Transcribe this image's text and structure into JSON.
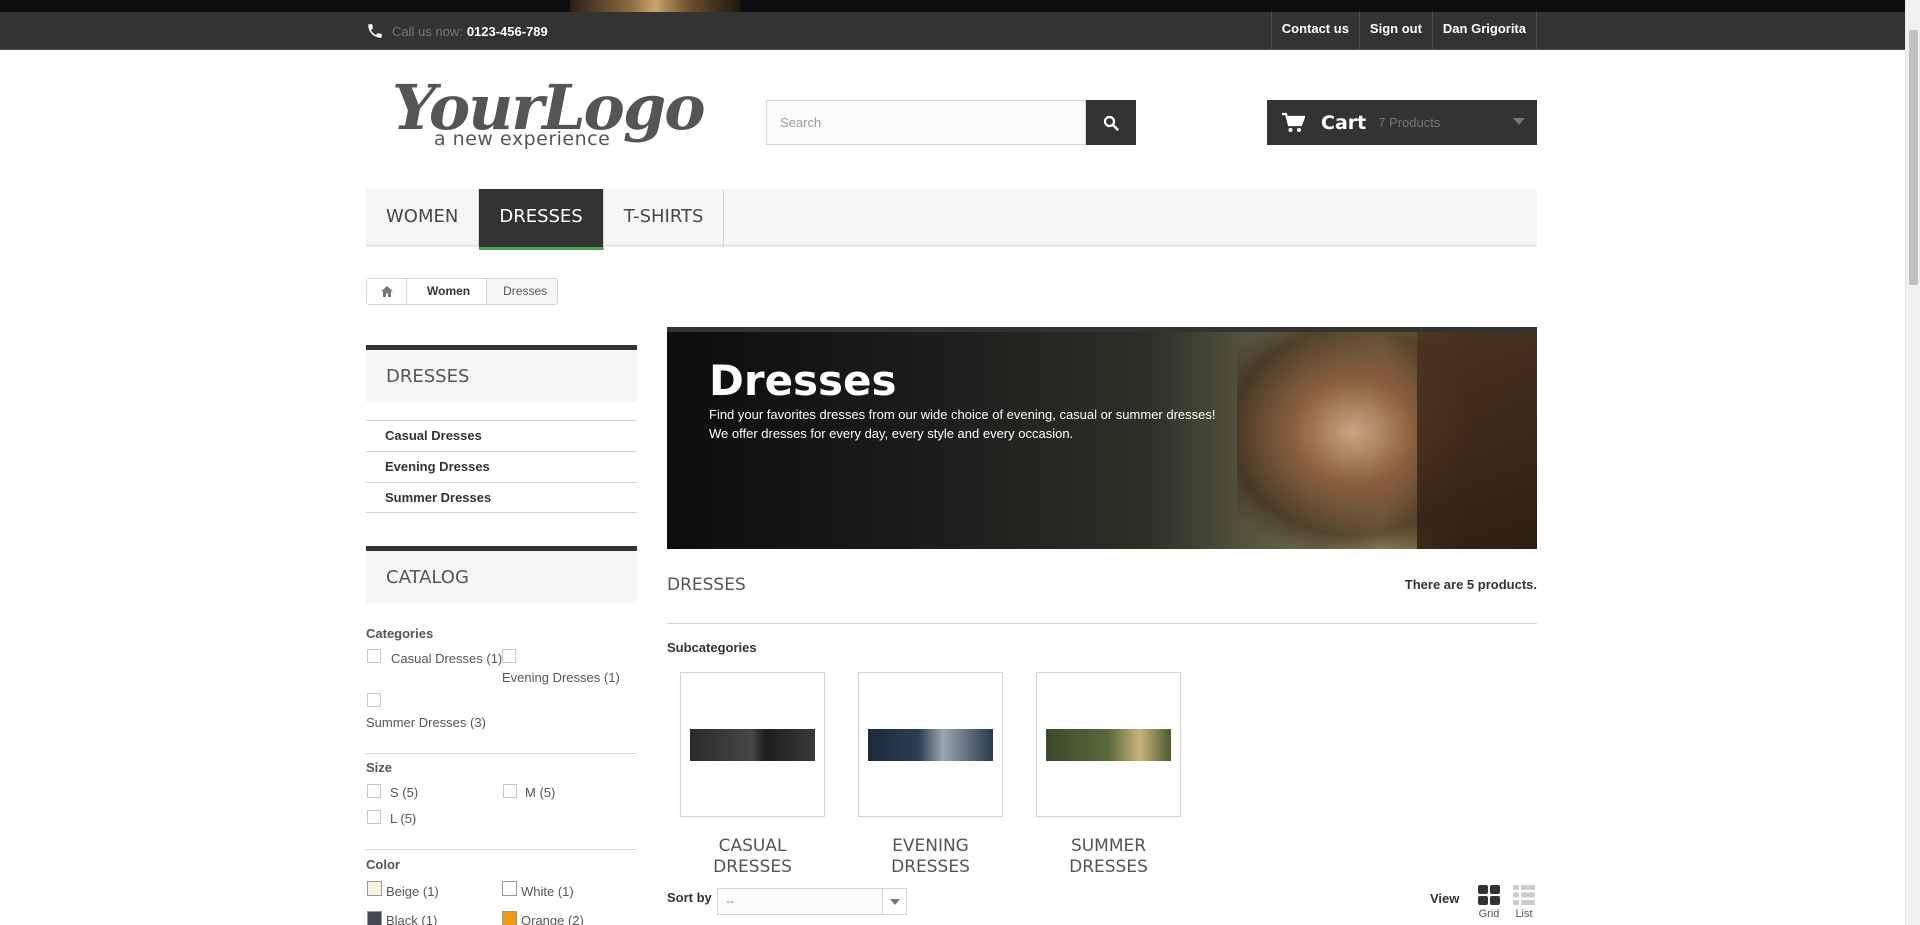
{
  "topbar": {
    "call_label": "Call us now:",
    "phone": "0123-456-789",
    "links": [
      "Contact us",
      "Sign out",
      "Dan Grigorita"
    ]
  },
  "logo": {
    "line1": "YourLogo",
    "line2": "a new experience"
  },
  "search": {
    "placeholder": "Search",
    "value": ""
  },
  "cart": {
    "label": "Cart",
    "quantity": "7 Products"
  },
  "menu": {
    "items": [
      "Women",
      "Dresses",
      "T-shirts"
    ],
    "active": "Dresses"
  },
  "breadcrumb": {
    "items": [
      "Women",
      "Dresses"
    ]
  },
  "sidebar": {
    "category_title": "Dresses",
    "subcategories": [
      "Casual Dresses",
      "Evening Dresses",
      "Summer Dresses"
    ],
    "catalog_title": "Catalog",
    "filters": {
      "categories": {
        "title": "Categories",
        "options": [
          "Casual Dresses (1)",
          "Evening Dresses (1)",
          "Summer Dresses (3)"
        ]
      },
      "size": {
        "title": "Size",
        "options": [
          "S (5)",
          "M (5)",
          "L (5)"
        ]
      },
      "color": {
        "title": "Color",
        "options": [
          {
            "label": "Beige (1)",
            "color": "#f5f5dc"
          },
          {
            "label": "White (1)",
            "color": "#ffffff"
          },
          {
            "label": "Black (1)",
            "color": "#434a54"
          },
          {
            "label": "Orange (2)",
            "color": "#f39c11"
          }
        ]
      }
    }
  },
  "hero": {
    "title": "Dresses",
    "line1": "Find your favorites dresses from our wide choice of evening, casual or summer dresses!",
    "line2": "We offer dresses for every day, every style and every occasion."
  },
  "listing": {
    "category_name": "Dresses",
    "count_text": "There are 5 products.",
    "subcategories_heading": "Subcategories",
    "subcategories": [
      {
        "line1": "CASUAL",
        "line2": "DRESSES"
      },
      {
        "line1": "EVENING",
        "line2": "DRESSES"
      },
      {
        "line1": "SUMMER",
        "line2": "DRESSES"
      }
    ],
    "sort_label": "Sort by",
    "sort_value": "--",
    "view_label": "View",
    "view_grid": "Grid",
    "view_list": "List"
  }
}
